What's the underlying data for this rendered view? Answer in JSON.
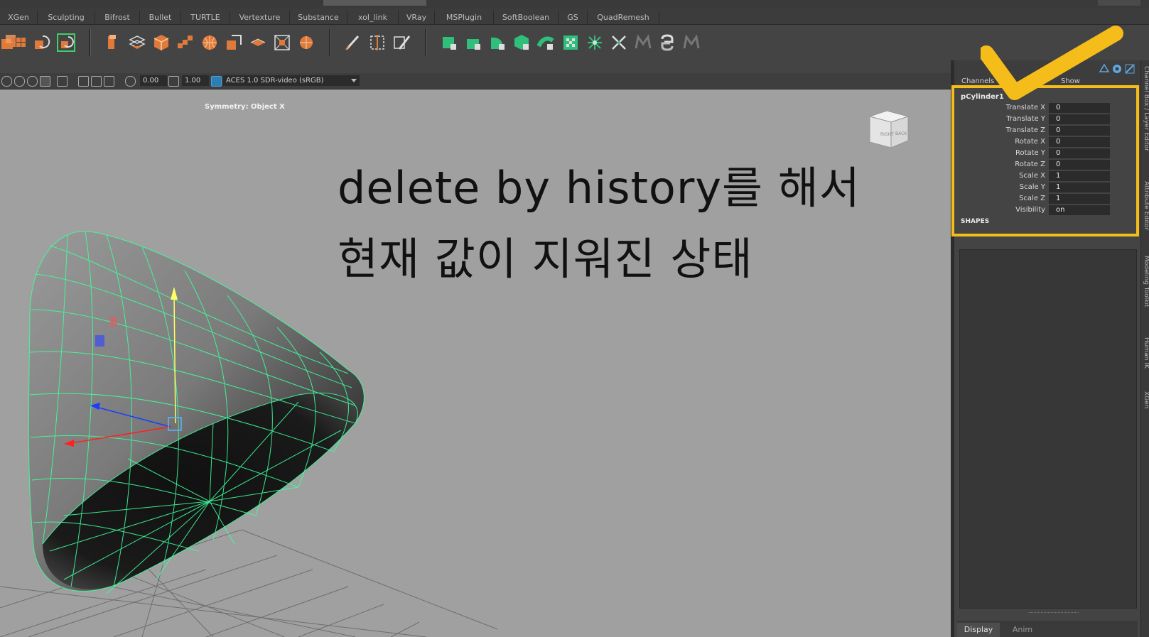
{
  "shelf_tabs": [
    "XGen",
    "Sculpting",
    "Bifrost",
    "Bullet",
    "TURTLE",
    "Vertexture",
    "Substance",
    "xol_link",
    "VRay",
    "MSPlugin",
    "SoftBoolean",
    "GS",
    "QuadRemesh"
  ],
  "viewport_toolbar": {
    "exposure_value": "0.00",
    "gamma_value": "1.00",
    "color_space": "ACES 1.0 SDR-video (sRGB)"
  },
  "viewport": {
    "symmetry_label": "Symmetry: Object X",
    "viewcube_right": "RIGHT",
    "viewcube_back": "BACK"
  },
  "annotation": {
    "line1": "delete by history를 해서",
    "line2": "현재 값이 지워진 상태"
  },
  "channel_box": {
    "header_channels": "Channels",
    "header_show": "Show",
    "object_name": "pCylinder1",
    "attributes": [
      {
        "label": "Translate X",
        "value": "0"
      },
      {
        "label": "Translate Y",
        "value": "0"
      },
      {
        "label": "Translate Z",
        "value": "0"
      },
      {
        "label": "Rotate X",
        "value": "0"
      },
      {
        "label": "Rotate Y",
        "value": "0"
      },
      {
        "label": "Rotate Z",
        "value": "0"
      },
      {
        "label": "Scale X",
        "value": "1"
      },
      {
        "label": "Scale Y",
        "value": "1"
      },
      {
        "label": "Scale Z",
        "value": "1"
      },
      {
        "label": "Visibility",
        "value": "on"
      }
    ],
    "shapes_label": "SHAPES"
  },
  "bottom_tabs": {
    "display": "Display",
    "anim": "Anim"
  },
  "side_tabs": [
    "Channel Box / Layer Editor",
    "Attribute Editor",
    "Modeling Toolkit",
    "Human IK",
    "XGen"
  ],
  "colors": {
    "highlight": "#f5bd1a",
    "wireframe": "#3dff9c",
    "checkmark": "#f5bd1a"
  }
}
